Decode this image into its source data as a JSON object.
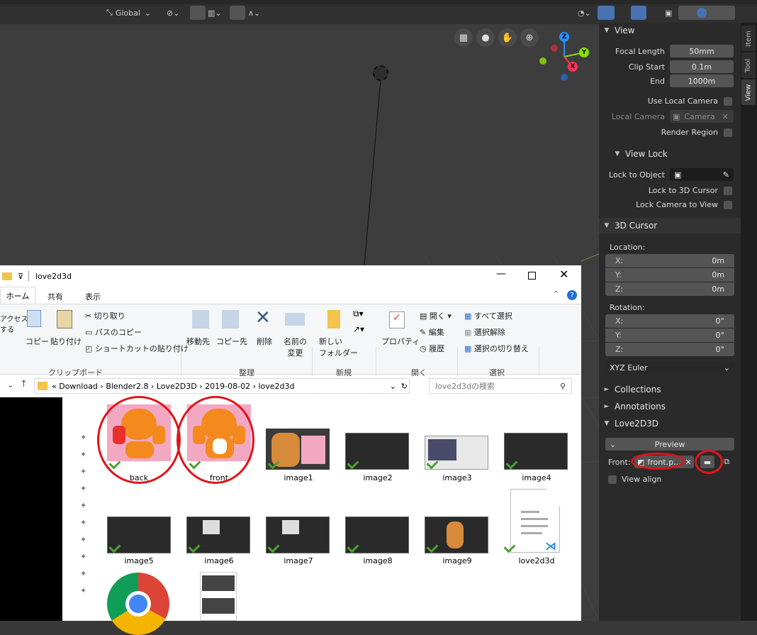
{
  "viewport_header": {
    "orientation": "Global"
  },
  "sidebar": {
    "tabs": [
      "Item",
      "Tool",
      "View"
    ],
    "view": {
      "title": "View",
      "focal_length_label": "Focal Length",
      "focal_length": "50mm",
      "clip_start_label": "Clip Start",
      "clip_start": "0.1m",
      "end_label": "End",
      "end": "1000m",
      "use_local_camera": "Use Local Camera",
      "local_camera_label": "Local Camera",
      "local_camera_value": "Camera",
      "render_region": "Render Region"
    },
    "view_lock": {
      "title": "View Lock",
      "lock_to_object": "Lock to Object",
      "lock_to_3d_cursor": "Lock to 3D Cursor",
      "lock_camera_to_view": "Lock Camera to View"
    },
    "cursor": {
      "title": "3D Cursor",
      "location_label": "Location:",
      "loc": [
        {
          "k": "X:",
          "v": "0m"
        },
        {
          "k": "Y:",
          "v": "0m"
        },
        {
          "k": "Z:",
          "v": "0m"
        }
      ],
      "rotation_label": "Rotation:",
      "rot": [
        {
          "k": "X:",
          "v": "0°"
        },
        {
          "k": "Y:",
          "v": "0°"
        },
        {
          "k": "Z:",
          "v": "0°"
        }
      ],
      "mode": "XYZ Euler"
    },
    "collections": "Collections",
    "annotations": "Annotations",
    "love2d3d": {
      "title": "Love2D3D",
      "preview": "Preview",
      "front_label": "Front:",
      "front_value": "front.p...",
      "view_align": "View align"
    }
  },
  "explorer": {
    "title": "love2d3d",
    "tabs": [
      "ホーム",
      "共有",
      "表示"
    ],
    "ribbon": {
      "access": "アクセス\nする",
      "copy": "コピー",
      "paste": "貼り付け",
      "cut": "切り取り",
      "copy_path": "パスのコピー",
      "paste_shortcut": "ショートカットの貼り付け",
      "clipboard": "クリップボード",
      "move_to": "移動先",
      "copy_to": "コピー先",
      "delete": "削除",
      "rename": "名前の\n変更",
      "organize": "整理",
      "new_folder": "新しい\nフォルダー",
      "new": "新規",
      "properties": "プロパティ",
      "open": "開く",
      "open_btn": "開く",
      "edit": "編集",
      "history": "履歴",
      "open_group": "開く",
      "select_all": "すべて選択",
      "select_none": "選択解除",
      "invert": "選択の切り替え",
      "select": "選択"
    },
    "breadcrumb": [
      "«",
      "Download",
      "Blender2.8",
      "Love2D3D",
      "2019-08-02",
      "love2d3d"
    ],
    "search_placeholder": "love2d3dの検索",
    "files": [
      "back",
      "front",
      "image1",
      "image2",
      "image3",
      "image4",
      "image5",
      "image6",
      "image7",
      "image8",
      "image9",
      "love2d3d"
    ]
  },
  "colors": {
    "blender_bg": "#3d3d3d",
    "panel": "#2a2a2a",
    "field": "#545454",
    "highlight": "#e0141b",
    "x_axis": "#ff3352",
    "y_axis": "#8bdc00",
    "z_axis": "#2890ff"
  }
}
